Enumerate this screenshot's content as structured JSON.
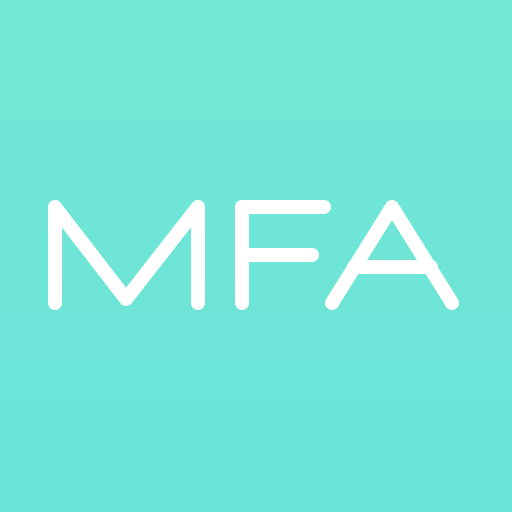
{
  "app_icon": {
    "text": "MFA",
    "background_color_top": "#73e8d6",
    "background_color_bottom": "#6ae2d8",
    "text_color": "#ffffff"
  }
}
